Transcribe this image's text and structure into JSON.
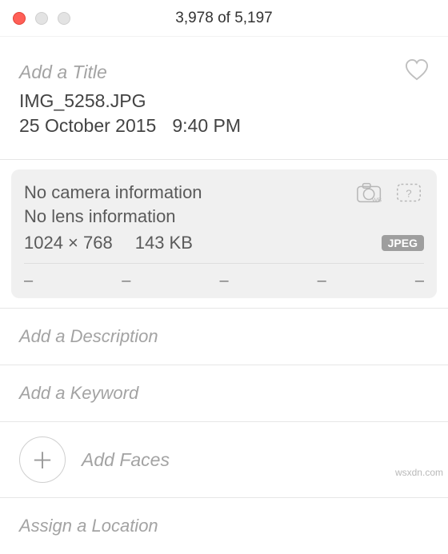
{
  "titlebar": {
    "count": "3,978 of 5,197"
  },
  "header": {
    "title_placeholder": "Add a Title",
    "filename": "IMG_5258.JPG",
    "date": "25 October 2015",
    "time": "9:40 PM"
  },
  "info": {
    "camera": "No camera information",
    "lens": "No lens information",
    "dimensions": "1024 × 768",
    "filesize": "143 KB",
    "format_badge": "JPEG",
    "meta_fields": [
      "–",
      "–",
      "–",
      "–",
      "–"
    ]
  },
  "fields": {
    "description_placeholder": "Add a Description",
    "keyword_placeholder": "Add a Keyword",
    "faces_label": "Add Faces",
    "location_placeholder": "Assign a Location"
  },
  "watermark": "wsxdn.com"
}
